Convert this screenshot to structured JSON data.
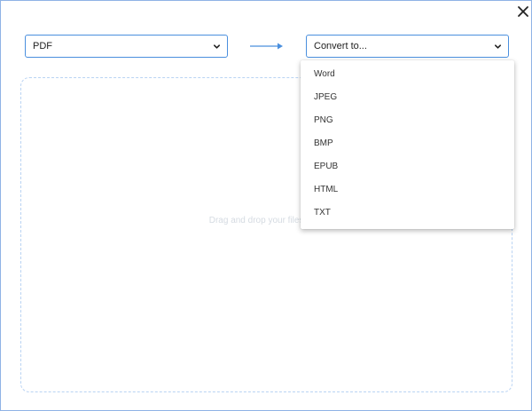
{
  "from_select": {
    "value": "PDF",
    "icon": "chevron-down-icon"
  },
  "to_select": {
    "placeholder": "Convert to...",
    "icon": "chevron-down-icon"
  },
  "convert_arrow_icon": "arrow-right-icon",
  "dropzone": {
    "text": "Drag and drop your files here"
  },
  "menu": {
    "items": [
      "Word",
      "JPEG",
      "PNG",
      "BMP",
      "EPUB",
      "HTML",
      "TXT"
    ]
  },
  "colors": {
    "accent": "#4a8fde",
    "border": "#8fb3e6",
    "dropzone_border": "#b9d3f3"
  }
}
